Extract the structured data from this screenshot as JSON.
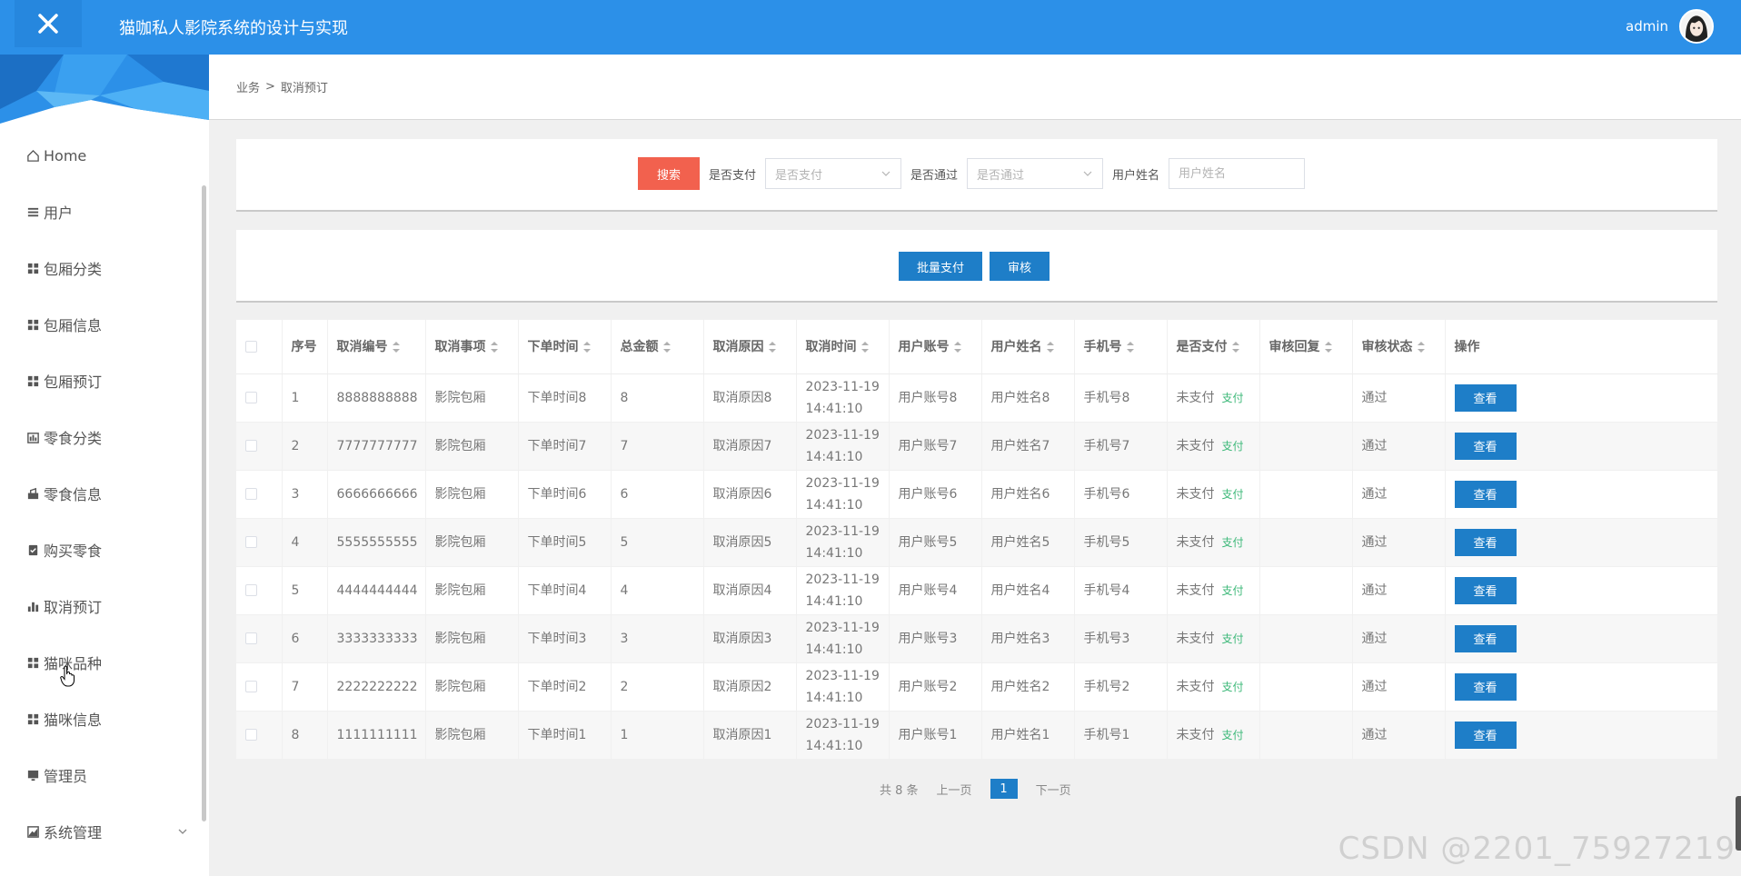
{
  "header": {
    "title": "猫咖私人影院系统的设计与实现",
    "username": "admin"
  },
  "sidebar": {
    "items": [
      {
        "label": "Home",
        "icon": "home-icon"
      },
      {
        "label": "用户",
        "icon": "list-icon"
      },
      {
        "label": "包厢分类",
        "icon": "grid-icon"
      },
      {
        "label": "包厢信息",
        "icon": "grid-icon"
      },
      {
        "label": "包厢预订",
        "icon": "grid-icon"
      },
      {
        "label": "零食分类",
        "icon": "chart-icon"
      },
      {
        "label": "零食信息",
        "icon": "bag-icon"
      },
      {
        "label": "购买零食",
        "icon": "clipboard-icon"
      },
      {
        "label": "取消预订",
        "icon": "bar-chart-icon"
      },
      {
        "label": "猫咪品种",
        "icon": "grid-icon"
      },
      {
        "label": "猫咪信息",
        "icon": "grid-icon"
      },
      {
        "label": "管理员",
        "icon": "monitor-icon"
      },
      {
        "label": "系统管理",
        "icon": "area-chart-icon"
      }
    ]
  },
  "breadcrumb": {
    "parent": "业务",
    "separator": ">",
    "current": "取消预订"
  },
  "search": {
    "button": "搜索",
    "paid_label": "是否支付",
    "paid_placeholder": "是否支付",
    "approved_label": "是否通过",
    "approved_placeholder": "是否通过",
    "name_label": "用户姓名",
    "name_placeholder": "用户姓名"
  },
  "actions": {
    "batch_pay": "批量支付",
    "review": "审核"
  },
  "table": {
    "headers": [
      "序号",
      "取消编号",
      "取消事项",
      "下单时间",
      "总金额",
      "取消原因",
      "取消时间",
      "用户账号",
      "用户姓名",
      "手机号",
      "是否支付",
      "审核回复",
      "审核状态",
      "操作"
    ],
    "pay_link": "支付",
    "view_button": "查看",
    "rows": [
      [
        "1",
        "8888888888",
        "影院包厢",
        "下单时间8",
        "8",
        "取消原因8",
        "2023-11-19",
        "14:41:10",
        "用户账号8",
        "用户姓名8",
        "手机号8",
        "未支付",
        "",
        "通过"
      ],
      [
        "2",
        "7777777777",
        "影院包厢",
        "下单时间7",
        "7",
        "取消原因7",
        "2023-11-19",
        "14:41:10",
        "用户账号7",
        "用户姓名7",
        "手机号7",
        "未支付",
        "",
        "通过"
      ],
      [
        "3",
        "6666666666",
        "影院包厢",
        "下单时间6",
        "6",
        "取消原因6",
        "2023-11-19",
        "14:41:10",
        "用户账号6",
        "用户姓名6",
        "手机号6",
        "未支付",
        "",
        "通过"
      ],
      [
        "4",
        "5555555555",
        "影院包厢",
        "下单时间5",
        "5",
        "取消原因5",
        "2023-11-19",
        "14:41:10",
        "用户账号5",
        "用户姓名5",
        "手机号5",
        "未支付",
        "",
        "通过"
      ],
      [
        "5",
        "4444444444",
        "影院包厢",
        "下单时间4",
        "4",
        "取消原因4",
        "2023-11-19",
        "14:41:10",
        "用户账号4",
        "用户姓名4",
        "手机号4",
        "未支付",
        "",
        "通过"
      ],
      [
        "6",
        "3333333333",
        "影院包厢",
        "下单时间3",
        "3",
        "取消原因3",
        "2023-11-19",
        "14:41:10",
        "用户账号3",
        "用户姓名3",
        "手机号3",
        "未支付",
        "",
        "通过"
      ],
      [
        "7",
        "2222222222",
        "影院包厢",
        "下单时间2",
        "2",
        "取消原因2",
        "2023-11-19",
        "14:41:10",
        "用户账号2",
        "用户姓名2",
        "手机号2",
        "未支付",
        "",
        "通过"
      ],
      [
        "8",
        "1111111111",
        "影院包厢",
        "下单时间1",
        "1",
        "取消原因1",
        "2023-11-19",
        "14:41:10",
        "用户账号1",
        "用户姓名1",
        "手机号1",
        "未支付",
        "",
        "通过"
      ]
    ]
  },
  "pagination": {
    "total": "共 8 条",
    "prev": "上一页",
    "current": "1",
    "next": "下一页"
  },
  "watermark": "CSDN @2201_75927219",
  "colors": {
    "header": "#2c90e8",
    "primary_button": "#1e7ec8",
    "search_button": "#f2614e",
    "pay_link": "#3cb878"
  }
}
